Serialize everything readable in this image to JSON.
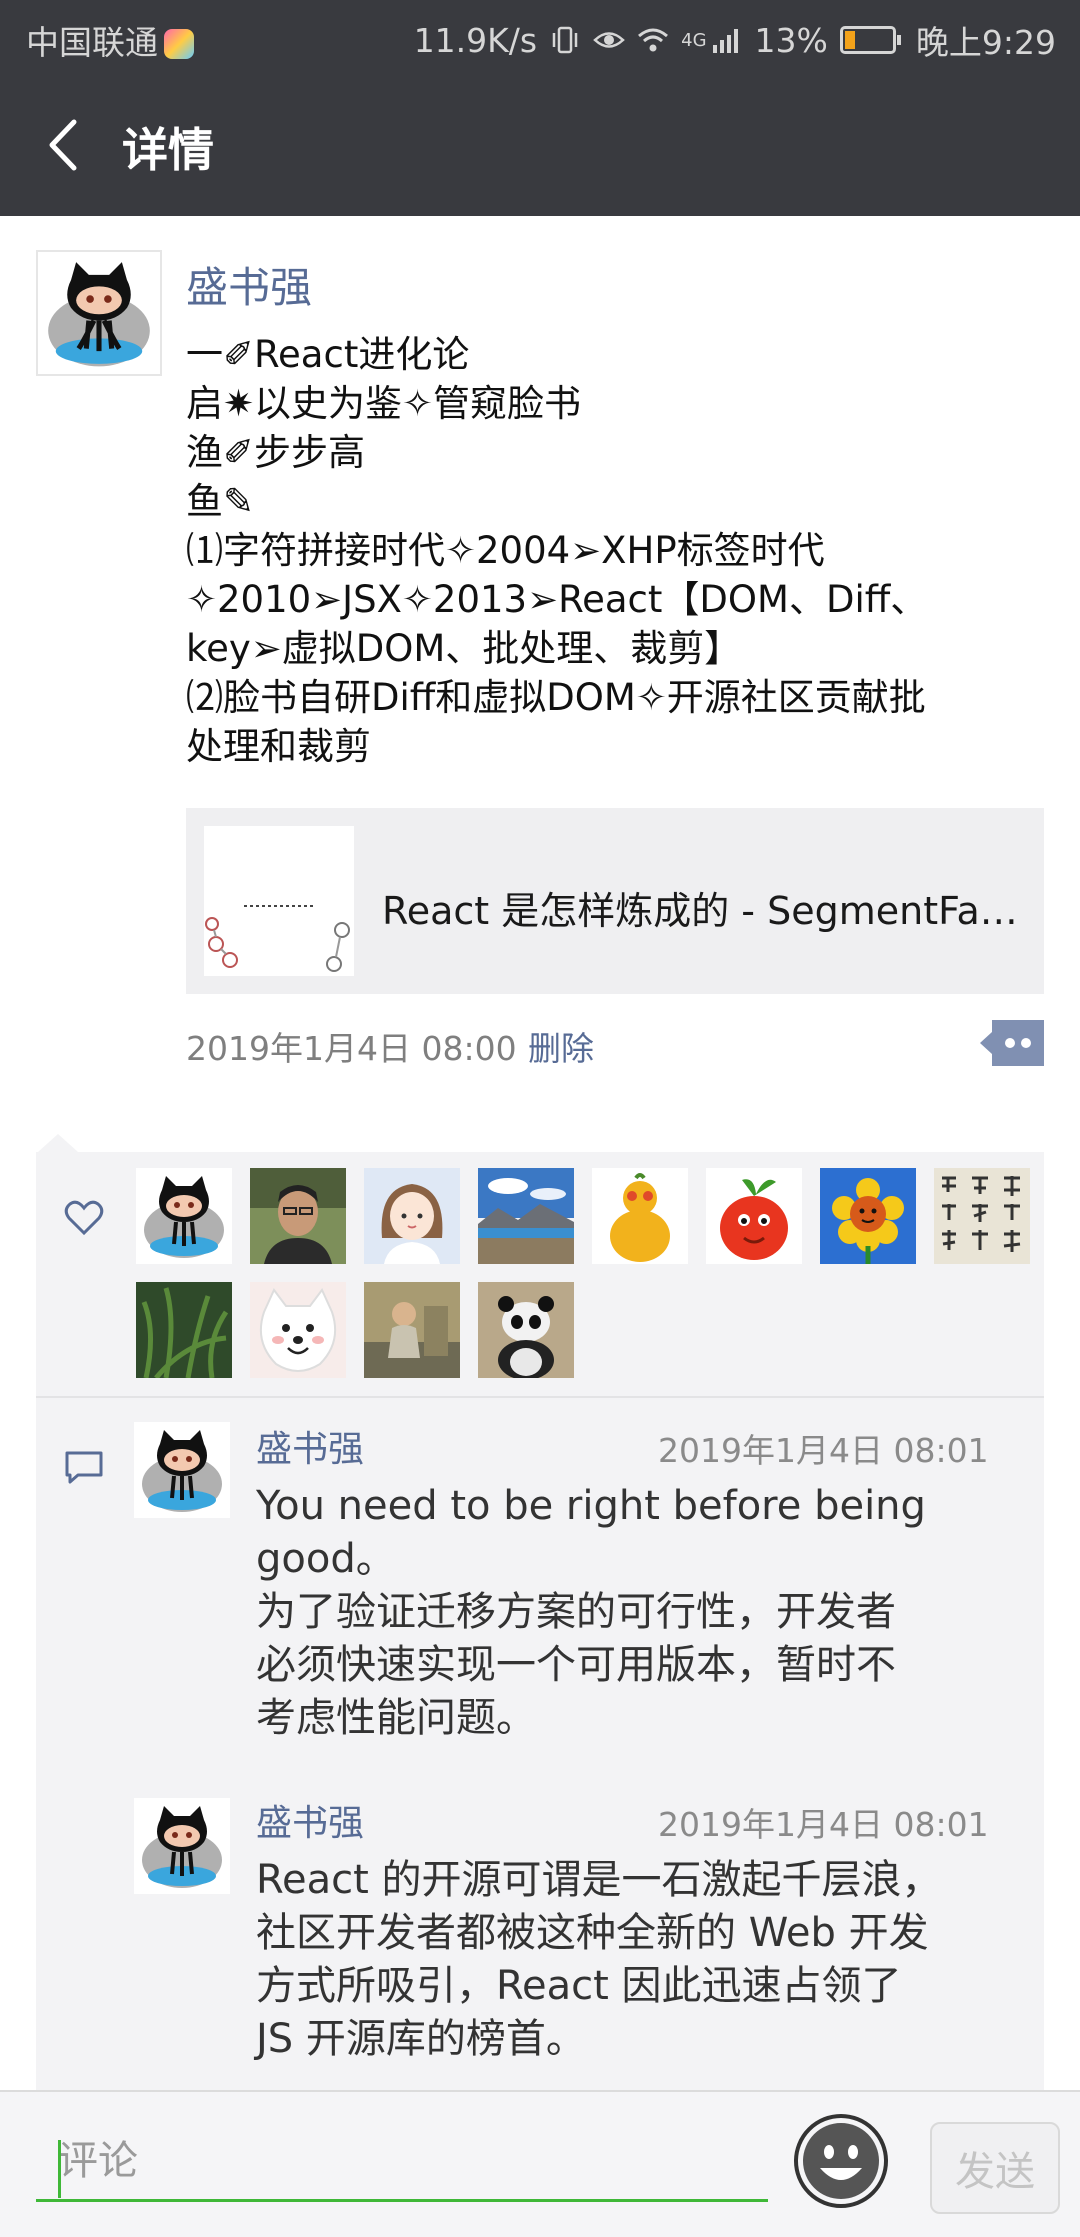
{
  "status_bar": {
    "carrier": "中国联通",
    "net_speed": "11.9K/s",
    "network": "4G",
    "battery": "13%",
    "time": "晚上9:29"
  },
  "header": {
    "title": "详情",
    "back_icon": "chevron-left-icon"
  },
  "post": {
    "author": "盛书强",
    "lines": [
      "一✐React进化论",
      "启✷以史为鉴✧管窥脸书",
      "渔✐步步高",
      "鱼✎",
      "⑴字符拼接时代✧2004➢XHP标签时代",
      "✧2010➢JSX✧2013➢React【DOM、Diff、",
      "key➢虚拟DOM、批处理、裁剪】",
      "⑵脸书自研Diff和虚拟DOM✧开源社区贡献批",
      "处理和裁剪"
    ],
    "link": {
      "title": "React 是怎样炼成的 - SegmentFault 思否"
    },
    "time": "2019年1月4日 08:00",
    "delete_label": "删除"
  },
  "likes": {
    "icon": "heart-icon",
    "users": [
      "octocat-avatar",
      "man-photo-avatar",
      "cartoon-girl-avatar",
      "landscape-avatar",
      "gourd-avatar",
      "orange-cartoon-avatar",
      "sunflower-avatar",
      "calligraphy-avatar",
      "plants-avatar",
      "white-dog-avatar",
      "child-photo-avatar",
      "kungfu-panda-avatar"
    ]
  },
  "comments": {
    "icon": "comment-icon",
    "items": [
      {
        "author": "盛书强",
        "time": "2019年1月4日 08:01",
        "lines": [
          "You need to be right before being",
          "good。",
          "为了验证迁移方案的可行性，开发者",
          "必须快速实现一个可用版本，暂时不",
          "考虑性能问题。"
        ]
      },
      {
        "author": "盛书强",
        "time": "2019年1月4日 08:01",
        "lines": [
          "React 的开源可谓是一石激起千层浪，",
          "社区开发者都被这种全新的 Web 开发",
          "方式所吸引，React 因此迅速占领了",
          "JS 开源库的榜首。"
        ]
      }
    ]
  },
  "input": {
    "placeholder": "评论",
    "emoji_icon": "smiley-icon",
    "send_label": "发送"
  },
  "colors": {
    "header_bg": "#393a3f",
    "name_blue": "#576b95",
    "input_green": "#3fb838"
  }
}
